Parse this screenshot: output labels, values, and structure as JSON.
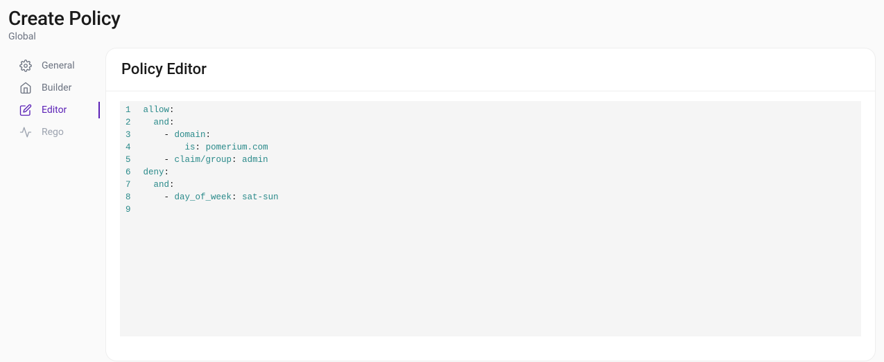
{
  "header": {
    "title": "Create Policy",
    "breadcrumb": "Global"
  },
  "sidebar": {
    "items": [
      {
        "id": "general",
        "label": "General",
        "icon": "gear-icon",
        "active": false,
        "disabled": false
      },
      {
        "id": "builder",
        "label": "Builder",
        "icon": "home-icon",
        "active": false,
        "disabled": false
      },
      {
        "id": "editor",
        "label": "Editor",
        "icon": "edit-icon",
        "active": true,
        "disabled": false
      },
      {
        "id": "rego",
        "label": "Rego",
        "icon": "activity-icon",
        "active": false,
        "disabled": true
      }
    ]
  },
  "panel": {
    "title": "Policy Editor"
  },
  "editor": {
    "line_numbers": [
      "1",
      "2",
      "3",
      "4",
      "5",
      "6",
      "7",
      "8",
      "9"
    ],
    "tokens": [
      [
        {
          "t": "allow",
          "c": "key"
        },
        {
          "t": ":",
          "c": "punct"
        }
      ],
      [
        {
          "t": "  ",
          "c": "plain"
        },
        {
          "t": "and",
          "c": "key"
        },
        {
          "t": ":",
          "c": "punct"
        }
      ],
      [
        {
          "t": "    - ",
          "c": "plain"
        },
        {
          "t": "domain",
          "c": "key"
        },
        {
          "t": ":",
          "c": "punct"
        }
      ],
      [
        {
          "t": "        ",
          "c": "plain"
        },
        {
          "t": "is",
          "c": "key"
        },
        {
          "t": ": ",
          "c": "punct"
        },
        {
          "t": "pomerium.com",
          "c": "val"
        }
      ],
      [
        {
          "t": "    - ",
          "c": "plain"
        },
        {
          "t": "claim/group",
          "c": "key"
        },
        {
          "t": ": ",
          "c": "punct"
        },
        {
          "t": "admin",
          "c": "val"
        }
      ],
      [
        {
          "t": "deny",
          "c": "key"
        },
        {
          "t": ":",
          "c": "punct"
        }
      ],
      [
        {
          "t": "  ",
          "c": "plain"
        },
        {
          "t": "and",
          "c": "key"
        },
        {
          "t": ":",
          "c": "punct"
        }
      ],
      [
        {
          "t": "    - ",
          "c": "plain"
        },
        {
          "t": "day_of_week",
          "c": "key"
        },
        {
          "t": ": ",
          "c": "punct"
        },
        {
          "t": "sat-sun",
          "c": "val"
        }
      ],
      [
        {
          "t": "",
          "c": "plain"
        }
      ]
    ]
  }
}
